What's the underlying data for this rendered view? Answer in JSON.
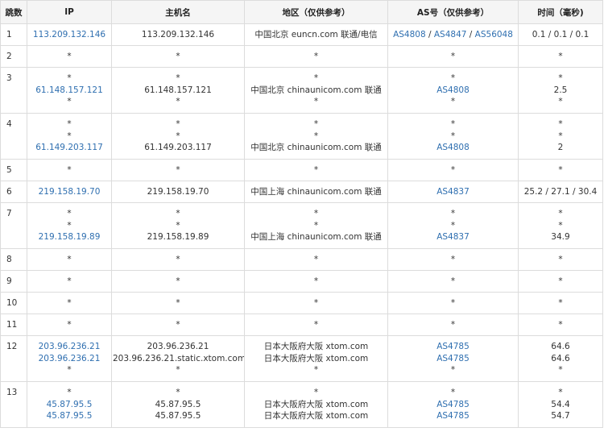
{
  "headers": {
    "hop": "跳数",
    "ip": "IP",
    "host": "主机名",
    "region": "地区（仅供参考）",
    "as": "AS号（仅供参考）",
    "time": "时间（毫秒)"
  },
  "colors": {
    "link": "#2f6fb0",
    "header_bg": "#f5f5f5",
    "border": "#dcdcdc",
    "text": "#333333"
  },
  "rows": [
    {
      "hop": "1",
      "lines": [
        {
          "ip": "113.209.132.146",
          "host": "113.209.132.146",
          "region": "中国北京 euncn.com 联通/电信",
          "as": [
            "AS4808",
            "AS4847",
            "AS56048"
          ],
          "time": "0.1 / 0.1 / 0.1"
        }
      ]
    },
    {
      "hop": "2",
      "lines": [
        {
          "ip": "*",
          "host": "*",
          "region": "*",
          "as": [
            "*"
          ],
          "time": "*"
        }
      ]
    },
    {
      "hop": "3",
      "lines": [
        {
          "ip": "*",
          "host": "*",
          "region": "*",
          "as": [
            "*"
          ],
          "time": "*"
        },
        {
          "ip": "61.148.157.121",
          "host": "61.148.157.121",
          "region": "中国北京 chinaunicom.com 联通",
          "as": [
            "AS4808"
          ],
          "time": "2.5"
        },
        {
          "ip": "*",
          "host": "*",
          "region": "*",
          "as": [
            "*"
          ],
          "time": "*"
        }
      ]
    },
    {
      "hop": "4",
      "lines": [
        {
          "ip": "*",
          "host": "*",
          "region": "*",
          "as": [
            "*"
          ],
          "time": "*"
        },
        {
          "ip": "*",
          "host": "*",
          "region": "*",
          "as": [
            "*"
          ],
          "time": "*"
        },
        {
          "ip": "61.149.203.117",
          "host": "61.149.203.117",
          "region": "中国北京 chinaunicom.com 联通",
          "as": [
            "AS4808"
          ],
          "time": "2"
        }
      ]
    },
    {
      "hop": "5",
      "lines": [
        {
          "ip": "*",
          "host": "*",
          "region": "*",
          "as": [
            "*"
          ],
          "time": "*"
        }
      ]
    },
    {
      "hop": "6",
      "lines": [
        {
          "ip": "219.158.19.70",
          "host": "219.158.19.70",
          "region": "中国上海 chinaunicom.com 联通",
          "as": [
            "AS4837"
          ],
          "time": "25.2 / 27.1 / 30.4"
        }
      ]
    },
    {
      "hop": "7",
      "lines": [
        {
          "ip": "*",
          "host": "*",
          "region": "*",
          "as": [
            "*"
          ],
          "time": "*"
        },
        {
          "ip": "*",
          "host": "*",
          "region": "*",
          "as": [
            "*"
          ],
          "time": "*"
        },
        {
          "ip": "219.158.19.89",
          "host": "219.158.19.89",
          "region": "中国上海 chinaunicom.com 联通",
          "as": [
            "AS4837"
          ],
          "time": "34.9"
        }
      ]
    },
    {
      "hop": "8",
      "lines": [
        {
          "ip": "*",
          "host": "*",
          "region": "*",
          "as": [
            "*"
          ],
          "time": "*"
        }
      ]
    },
    {
      "hop": "9",
      "lines": [
        {
          "ip": "*",
          "host": "*",
          "region": "*",
          "as": [
            "*"
          ],
          "time": "*"
        }
      ]
    },
    {
      "hop": "10",
      "lines": [
        {
          "ip": "*",
          "host": "*",
          "region": "*",
          "as": [
            "*"
          ],
          "time": "*"
        }
      ]
    },
    {
      "hop": "11",
      "lines": [
        {
          "ip": "*",
          "host": "*",
          "region": "*",
          "as": [
            "*"
          ],
          "time": "*"
        }
      ]
    },
    {
      "hop": "12",
      "lines": [
        {
          "ip": "203.96.236.21",
          "host": "203.96.236.21",
          "region": "日本大阪府大阪 xtom.com",
          "as": [
            "AS4785"
          ],
          "time": "64.6"
        },
        {
          "ip": "203.96.236.21",
          "host": "203.96.236.21.static.xtom.com",
          "region": "日本大阪府大阪 xtom.com",
          "as": [
            "AS4785"
          ],
          "time": "64.6"
        },
        {
          "ip": "*",
          "host": "*",
          "region": "*",
          "as": [
            "*"
          ],
          "time": "*"
        }
      ]
    },
    {
      "hop": "13",
      "lines": [
        {
          "ip": "*",
          "host": "*",
          "region": "*",
          "as": [
            "*"
          ],
          "time": "*"
        },
        {
          "ip": "45.87.95.5",
          "host": "45.87.95.5",
          "region": "日本大阪府大阪 xtom.com",
          "as": [
            "AS4785"
          ],
          "time": "54.4"
        },
        {
          "ip": "45.87.95.5",
          "host": "45.87.95.5",
          "region": "日本大阪府大阪 xtom.com",
          "as": [
            "AS4785"
          ],
          "time": "54.7"
        }
      ]
    }
  ]
}
